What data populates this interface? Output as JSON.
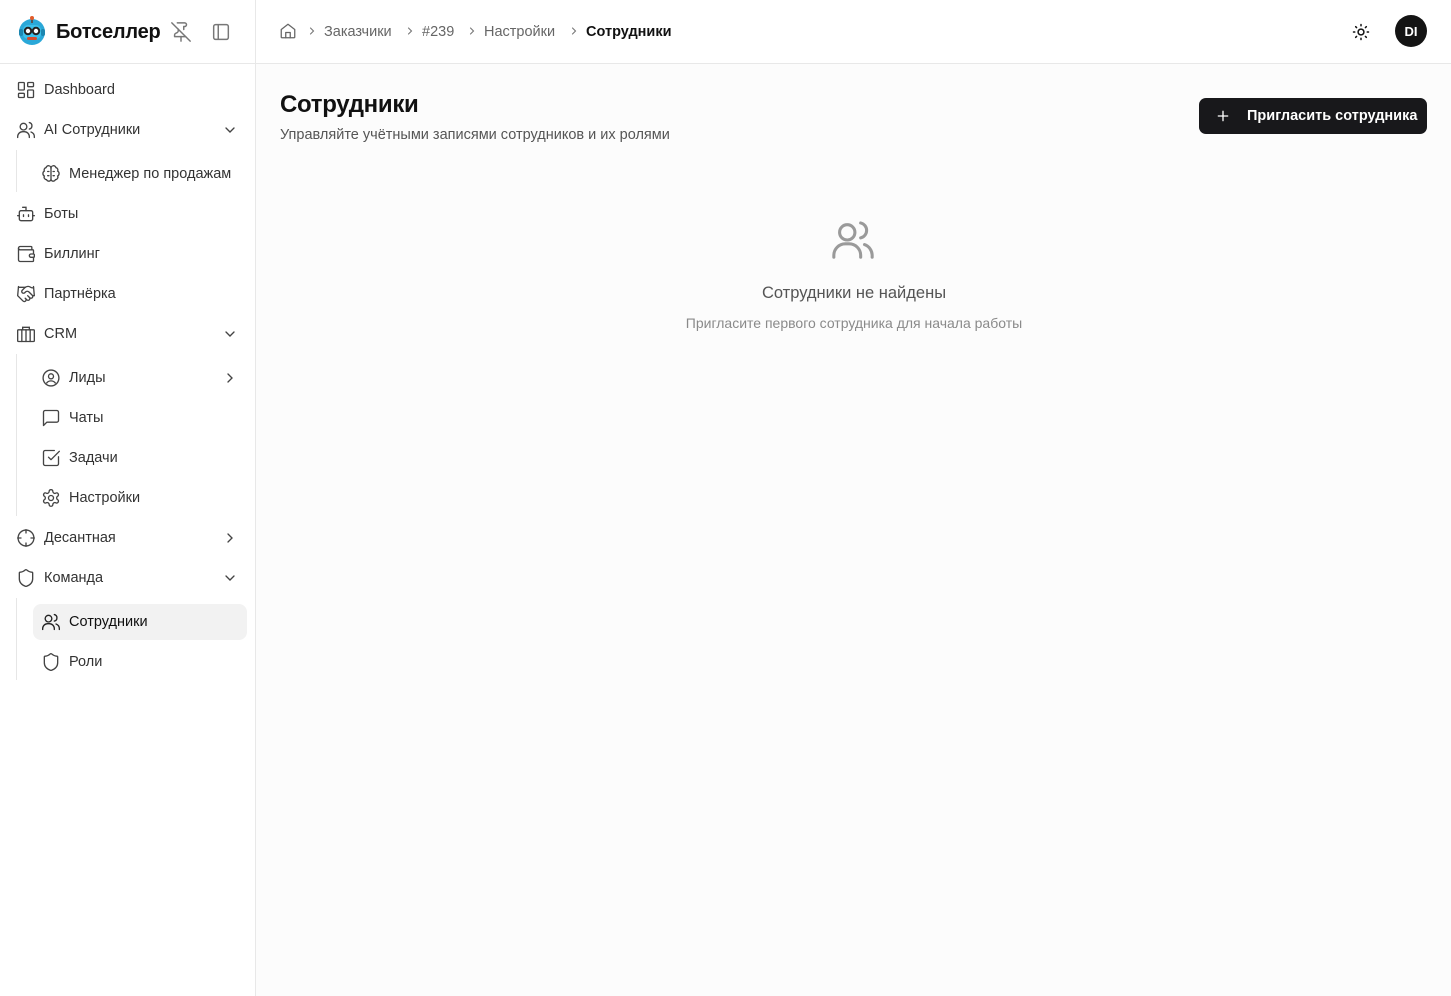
{
  "brand": {
    "name": "Ботселлер",
    "logo_icon": "robot-mascot-icon"
  },
  "sidebar": {
    "dashboard": "Dashboard",
    "ai_staff": "AI Сотрудники",
    "sales_manager": "Менеджер по продажам",
    "bots": "Боты",
    "billing": "Биллинг",
    "partner": "Партнёрка",
    "crm": "CRM",
    "leads": "Лиды",
    "chats": "Чаты",
    "tasks": "Задачи",
    "settings": "Настройки",
    "landing": "Десантная",
    "team": "Команда",
    "employees": "Сотрудники",
    "roles": "Роли"
  },
  "breadcrumb": {
    "items": [
      "Заказчики",
      "#239",
      "Настройки"
    ],
    "current": "Сотрудники"
  },
  "header": {
    "avatar_initials": "DI"
  },
  "main": {
    "title": "Сотрудники",
    "subtitle": "Управляйте учётными записями сотрудников и их ролями",
    "invite_button": "Пригласить сотрудника",
    "empty_title": "Сотрудники не найдены",
    "empty_subtitle": "Пригласите первого сотрудника для начала работы"
  },
  "colors": {
    "primary_button": "#18181b",
    "active_item_bg": "#f2f2f2",
    "border": "#e8e8e8"
  }
}
